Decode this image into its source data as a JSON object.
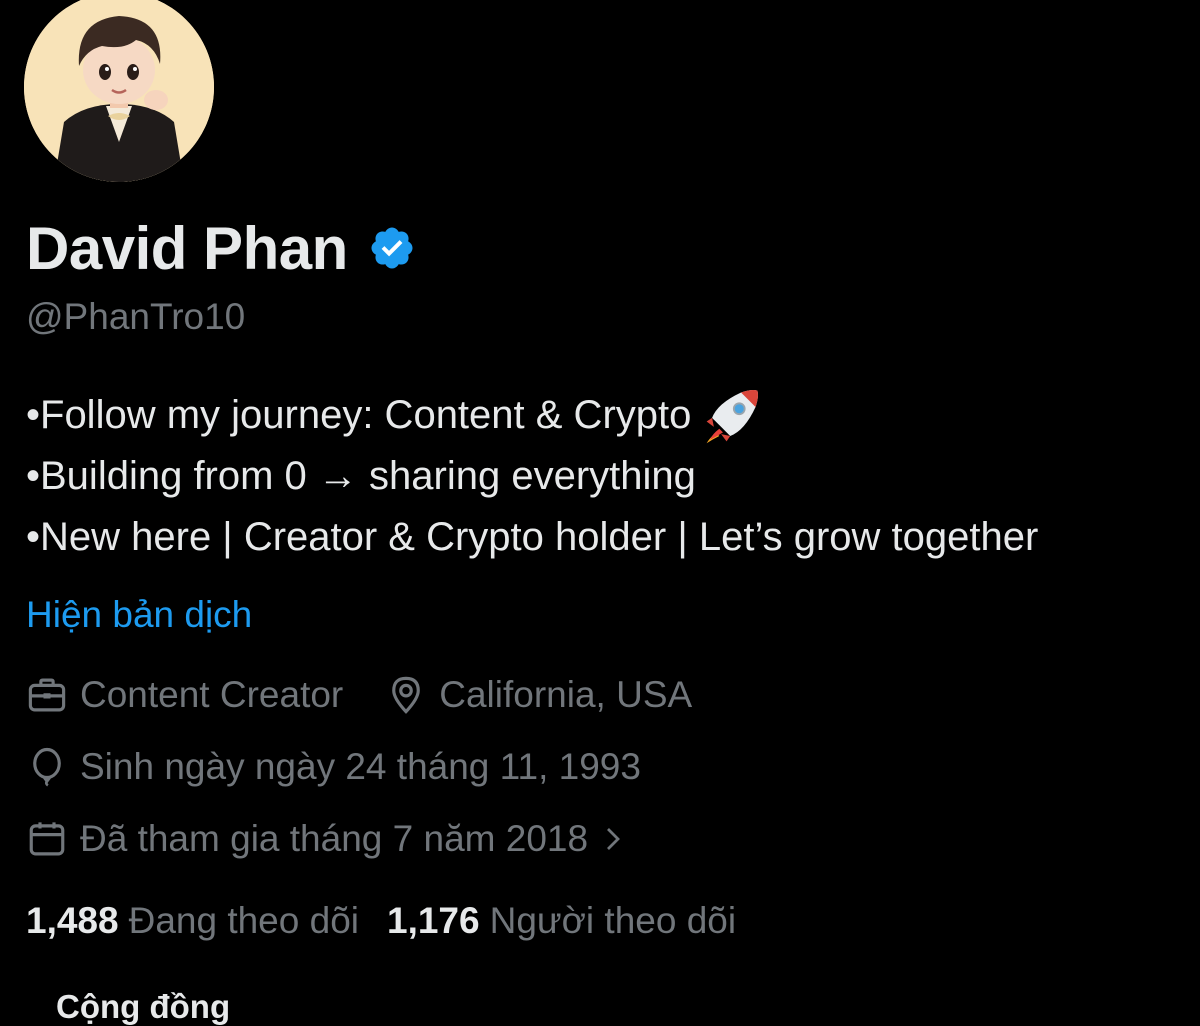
{
  "profile": {
    "display_name": "David Phan",
    "handle": "@PhanTro10",
    "verified": true,
    "accent_color": "#1d9bf0"
  },
  "bio": {
    "lines": [
      "•Follow my journey: Content & Crypto",
      "•Building from 0 → sharing everything",
      "•New here | Creator & Crypto holder | Let’s grow together"
    ],
    "emoji": "rocket-icon"
  },
  "translate_link": "Hiện bản dịch",
  "meta": {
    "profession": "Content Creator",
    "location": "California, USA",
    "birthday": "Sinh ngày ngày 24 tháng 11, 1993",
    "joined": "Đã tham gia tháng 7 năm 2018"
  },
  "stats": {
    "following_count": "1,488",
    "following_label": "Đang theo dõi",
    "followers_count": "1,176",
    "followers_label": "Người theo dõi"
  },
  "tabs": {
    "community_label": "Cộng đồng"
  }
}
